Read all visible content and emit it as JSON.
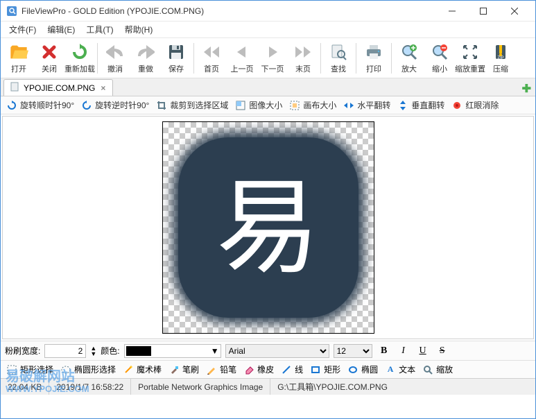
{
  "window": {
    "title": "FileViewPro - GOLD Edition (YPOJIE.COM.PNG)"
  },
  "menu": {
    "file": "文件(F)",
    "edit": "编辑(E)",
    "tools": "工具(T)",
    "help": "帮助(H)"
  },
  "toolbar": {
    "open": "打开",
    "close": "关闭",
    "reload": "重新加载",
    "undo": "撤消",
    "redo": "重做",
    "save": "保存",
    "first": "首页",
    "prev": "上一页",
    "next": "下一页",
    "last": "末页",
    "find": "查找",
    "print": "打印",
    "zoomin": "放大",
    "zoomout": "缩小",
    "zoomreset": "缩放重置",
    "compress": "压缩"
  },
  "tab": {
    "label": "YPOJIE.COM.PNG"
  },
  "subtoolbar": {
    "rotate_cw": "旋转顺时针90°",
    "rotate_ccw": "旋转逆时针90°",
    "crop": "裁剪到选择区域",
    "image_size": "图像大小",
    "canvas_size": "画布大小",
    "flip_h": "水平翻转",
    "flip_v": "垂直翻转",
    "redeye": "红眼消除"
  },
  "image_glyph": "易",
  "watermark": {
    "line1": "易破解网站",
    "line2": "WWW.YPOJIE.COM"
  },
  "props": {
    "brush_label": "粉刷宽度:",
    "brush_value": "2",
    "color_label": "颜色:",
    "font_name": "Arial",
    "font_size": "12"
  },
  "drawbar": {
    "rect_select": "矩形选择",
    "ellipse_select": "椭圆形选择",
    "magic": "魔术棒",
    "brush": "笔刷",
    "pencil": "铅笔",
    "eraser": "橡皮",
    "line": "线",
    "rect": "矩形",
    "ellipse": "椭圆",
    "text": "文本",
    "zoom": "缩放"
  },
  "status": {
    "size": "22.04 KB",
    "date": "2019/1/7 16:58:22",
    "type": "Portable Network Graphics Image",
    "path": "G:\\工具箱\\YPOJIE.COM.PNG"
  }
}
